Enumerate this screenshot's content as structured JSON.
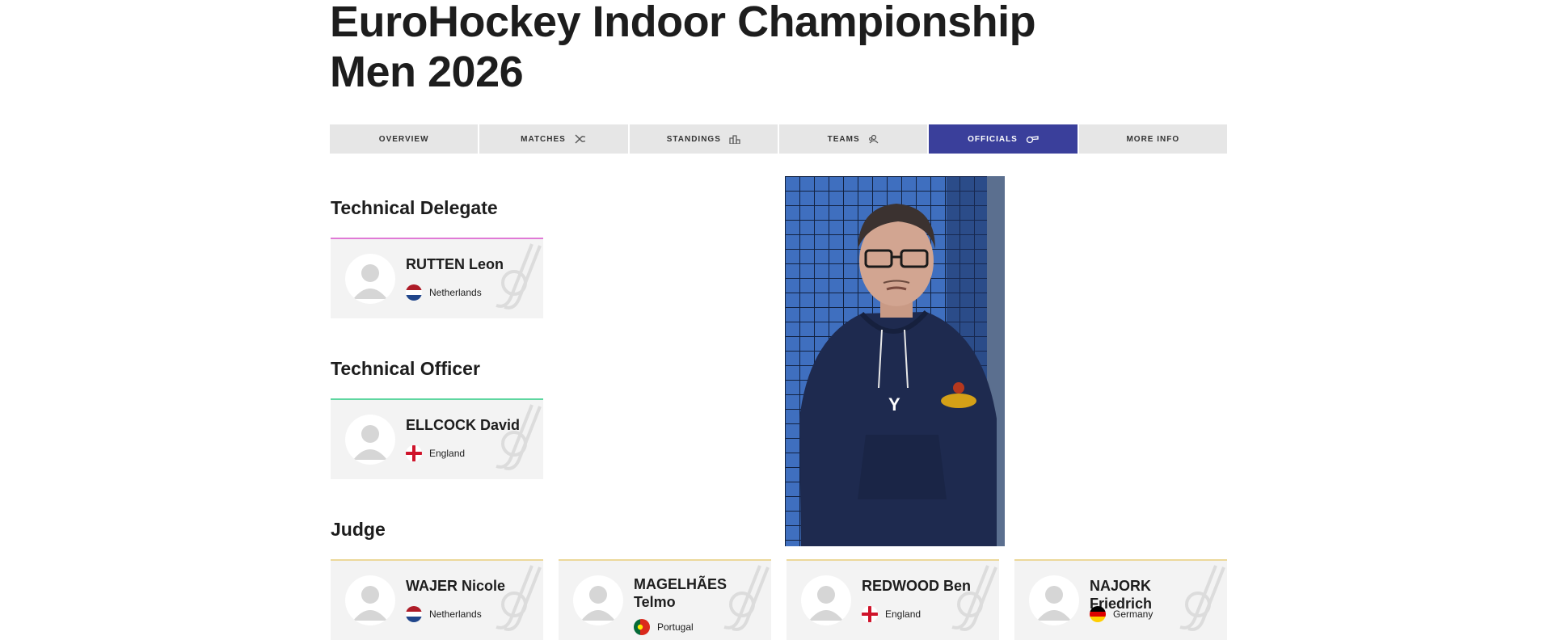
{
  "page": {
    "title_line1": "EuroHockey Indoor Championship",
    "title_line2": "Men 2026"
  },
  "tabs": [
    {
      "label": "OVERVIEW",
      "icon": "",
      "active": false
    },
    {
      "label": "MATCHES",
      "icon": "hockey-sticks-icon",
      "active": false
    },
    {
      "label": "STANDINGS",
      "icon": "podium-icon",
      "active": false
    },
    {
      "label": "TEAMS",
      "icon": "team-icon",
      "active": false
    },
    {
      "label": "OFFICIALS",
      "icon": "whistle-icon",
      "active": true
    },
    {
      "label": "MORE INFO",
      "icon": "",
      "active": false
    }
  ],
  "sections": {
    "technical_delegate": {
      "heading": "Technical Delegate",
      "accent": "#e07ad6",
      "officials": [
        {
          "name": "RUTTEN Leon",
          "country": "Netherlands",
          "flag": "netherlands-flag"
        }
      ]
    },
    "technical_officer": {
      "heading": "Technical Officer",
      "accent": "#5fd6a0",
      "officials": [
        {
          "name": "ELLCOCK David",
          "country": "England",
          "flag": "england-flag"
        }
      ]
    },
    "judge": {
      "heading": "Judge",
      "accent": "#ecd89a",
      "officials": [
        {
          "name": "WAJER Nicole",
          "country": "Netherlands",
          "flag": "netherlands-flag"
        },
        {
          "name": "MAGELHÃES Telmo",
          "country": "Portugal",
          "flag": "portugal-flag"
        },
        {
          "name": "REDWOOD Ben",
          "country": "England",
          "flag": "england-flag"
        },
        {
          "name": "NAJORK Friedrich",
          "country": "Germany",
          "flag": "germany-flag"
        }
      ]
    }
  },
  "photo": {
    "subject": "official-portrait-photo"
  },
  "colors": {
    "active_tab": "#3a3f9b",
    "tab_bg": "#e6e6e6",
    "card_bg": "#f3f3f3"
  }
}
